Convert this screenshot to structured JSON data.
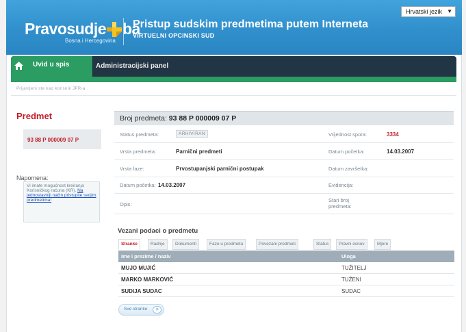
{
  "header": {
    "logo_left": "Pravosudje",
    "logo_right": "ba",
    "logo_sub": "Bosna i Hercegovina",
    "title": "Pristup sudskim predmetima putem Interneta",
    "subtitle": "VIRTUELNI OPCINSKI SUD",
    "language": "Hrvatski jezik"
  },
  "nav": {
    "tabs": [
      {
        "label": "Uvid u spis"
      },
      {
        "label": "Administracijski panel"
      }
    ]
  },
  "breadcrumb": "Prijavljeni ste kao korisnik JPR-a",
  "sidebar": {
    "title": "Predmet",
    "case_number": "93 88 P 000009 07 P",
    "note_label": "Napomena:",
    "note_text": "Vi imate mogućnost kreiranja Korisničkog računa (KR).",
    "note_link": "Na jednostavniji način pristupite svojim predmetima!"
  },
  "case": {
    "header_label": "Broj predmeta:",
    "header_value": "93 88 P 000009 07 P",
    "fields": {
      "status_label": "Status predmeta:",
      "status_value": "ARHIVIRAN",
      "dispute_label": "Vrijednost spora:",
      "dispute_value": "3334",
      "type_label": "Vrsta predmeta:",
      "type_value": "Parnični predmeti",
      "start_label": "Datum početka:",
      "start_value": "14.03.2007",
      "phase_label": "Vrsta faze:",
      "phase_value": "Prvostupanjski parnični postupak",
      "end_label": "Datum završetka:",
      "end_value": "",
      "phase_start_label": "Datum početka:",
      "phase_start_value": "14.03.2007",
      "evidence_label": "Evidencija:",
      "evidence_value": "",
      "desc_label": "Opis:",
      "desc_value": "",
      "old_number_label": "Stari broj predmeta:",
      "old_number_value": ""
    }
  },
  "linked": {
    "title": "Vezani podaci o predmetu",
    "tabs": [
      "Stranke",
      "Radnje",
      "Dokumenti",
      "Faze u predmetu",
      "Povezani predmeti",
      "Status",
      "Pravni osnov",
      "Mjere"
    ],
    "columns": [
      "Ime i prezime / naziv",
      "Uloga"
    ],
    "rows": [
      {
        "name": "MUJO MUJIĆ",
        "role": "TUŽITELJ"
      },
      {
        "name": "MARKO MARKOVIĆ",
        "role": "TUŽENI"
      },
      {
        "name": "SUDIJA SUDAC",
        "role": "SUDAC"
      }
    ],
    "see_all": "Sve stranke"
  },
  "colors": {
    "header_blue": "#2f8ecb",
    "nav_dark": "#223544",
    "accent_green": "#2b9c62",
    "accent_red": "#c21d28"
  }
}
